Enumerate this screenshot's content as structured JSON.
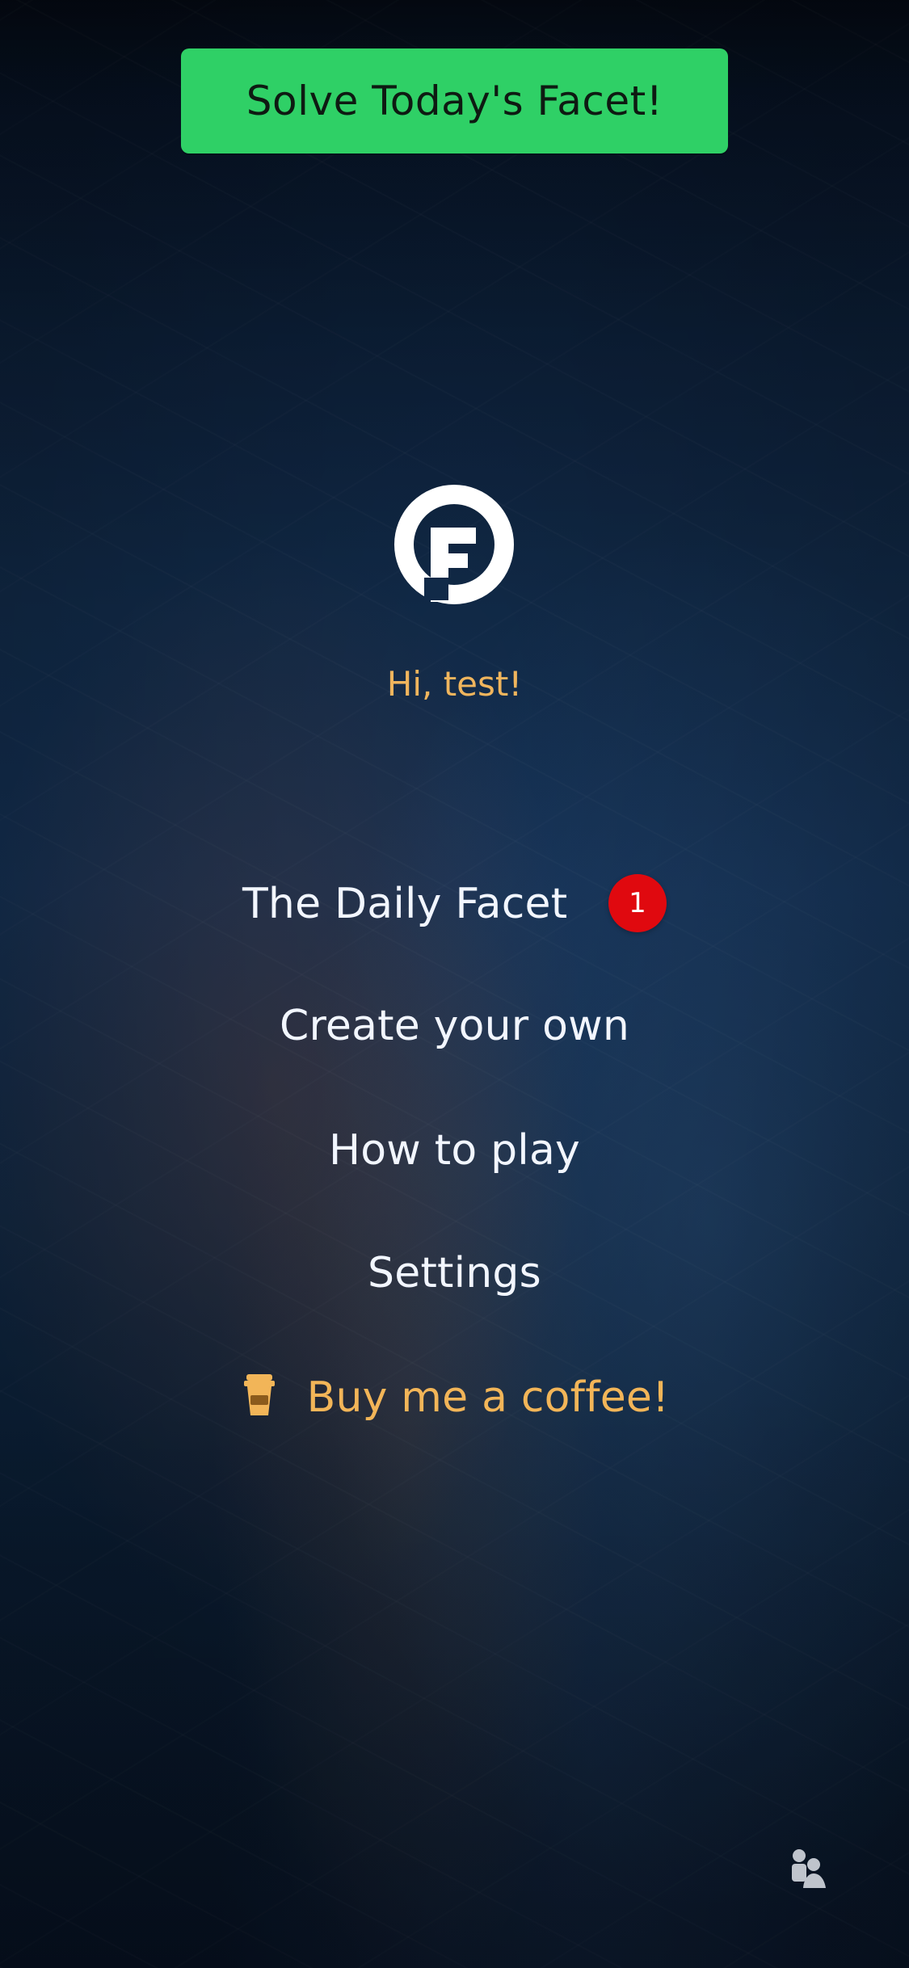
{
  "header": {
    "cta_label": "Solve Today's Facet!",
    "cta_color": "#2fd066"
  },
  "brand": {
    "logo_icon": "facet-logo-icon"
  },
  "greeting": {
    "text": "Hi, test!",
    "color": "#f0b55d"
  },
  "menu": {
    "items": [
      {
        "label": "The Daily Facet",
        "badge": "1",
        "badge_color": "#e0090f"
      },
      {
        "label": "Create your own"
      },
      {
        "label": "How to play"
      },
      {
        "label": "Settings"
      },
      {
        "label": "Buy me a coffee!",
        "icon": "coffee-cup-icon",
        "accent": "#f2b558"
      }
    ]
  },
  "footer": {
    "friends_icon": "friends-icon"
  }
}
